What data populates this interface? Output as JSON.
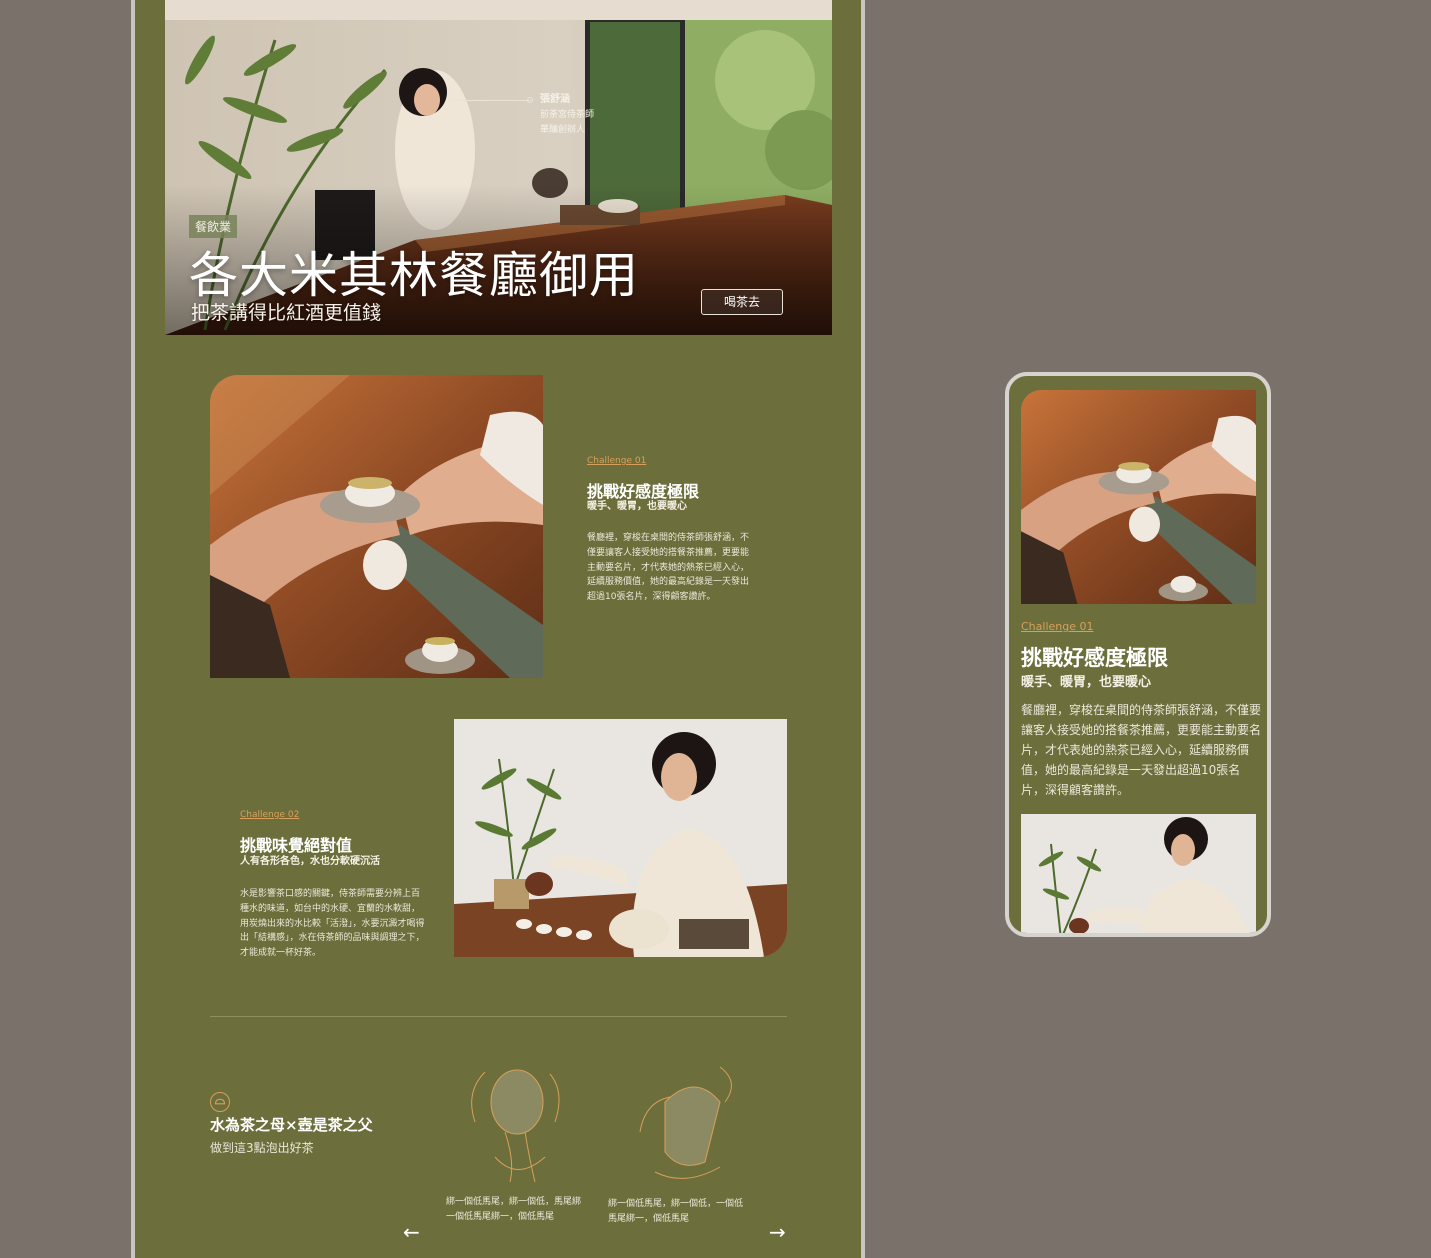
{
  "hero": {
    "tag": "餐飲業",
    "title": "各大米其林餐廳御用",
    "subtitle": "把茶講得比紅酒更值錢",
    "cta": "喝茶去",
    "person_name": "張舒涵",
    "person_role_1": "前荼宮侍茶師",
    "person_role_2": "華釀創辦人"
  },
  "challenge1": {
    "label": "Challenge 01",
    "title": "挑戰好感度極限",
    "subtitle": "暖手、暖胃，也要暖心",
    "body": "餐廳裡，穿梭在桌間的侍茶師張舒涵，不僅要讓客人接受她的搭餐茶推薦，更要能主動要名片，才代表她的熱茶已經入心，延續服務價值，她的最高紀錄是一天發出超過10張名片，深得顧客讚許。"
  },
  "challenge2": {
    "label": "Challenge 02",
    "title": "挑戰味覺絕對值",
    "subtitle": "人有各形各色，水也分軟硬沉活",
    "body": "水是影響茶口感的關鍵，侍茶師需要分辨上百種水的味道，如台中的水硬、宜蘭的水軟甜，用炭燒出來的水比較「活潑」，水要沉澱才喝得出「結構感」，水在侍茶師的品味與調理之下，才能成就一杯好茶。"
  },
  "tips": {
    "title": "水為茶之母×壺是茶之父",
    "subtitle": "做到這3點泡出好茶",
    "items": [
      {
        "text": "綁一個低馬尾，綁一個低，馬尾綁一個低馬尾綁一，個低馬尾"
      },
      {
        "text": "綁一個低馬尾，綁一個低，一個低馬尾綁一，個低馬尾"
      }
    ],
    "prev": "←",
    "next": "→"
  },
  "mobile": {
    "label": "Challenge 01",
    "title": "挑戰好感度極限",
    "subtitle": "暖手、暖胃，也要暖心",
    "body": "餐廳裡，穿梭在桌間的侍茶師張舒涵，不僅要讓客人接受她的搭餐茶推薦，更要能主動要名片，才代表她的熱茶已經入心，延續服務價值，她的最高紀錄是一天發出超過10張名片，深得顧客讚許。"
  },
  "colors": {
    "background": "#7b716b",
    "panel": "#6c6e3c",
    "accent": "#d7a05a",
    "frame": "#c9c5c0"
  }
}
